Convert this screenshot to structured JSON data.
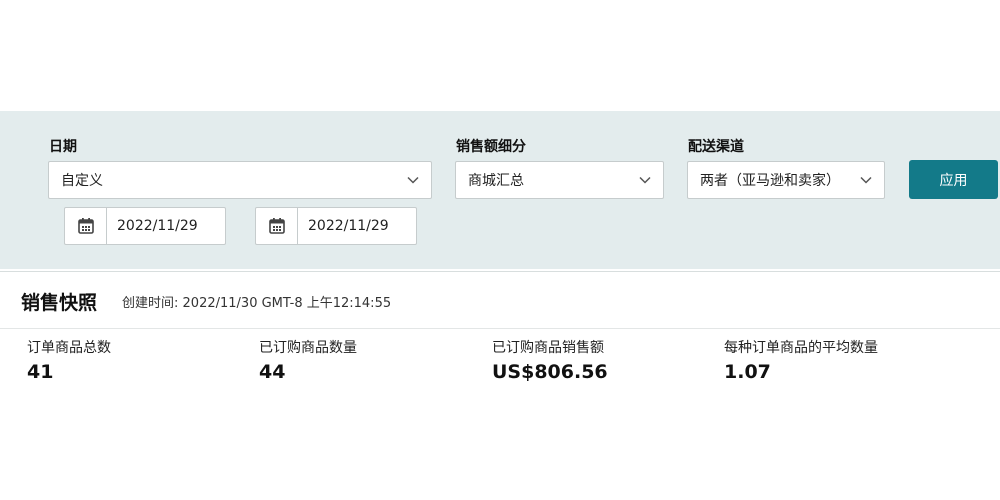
{
  "filters": {
    "date": {
      "label": "日期",
      "selected": "自定义",
      "start": "2022/11/29",
      "end": "2022/11/29"
    },
    "sales_breakdown": {
      "label": "销售额细分",
      "selected": "商城汇总"
    },
    "fulfillment": {
      "label": "配送渠道",
      "selected": "两者（亚马逊和卖家）"
    },
    "apply_label": "应用"
  },
  "snapshot": {
    "title": "销售快照",
    "created_label": "创建时间:",
    "created_value": "2022/11/30 GMT-8 上午12:14:55",
    "metrics": [
      {
        "label": "订单商品总数",
        "value": "41"
      },
      {
        "label": "已订购商品数量",
        "value": "44"
      },
      {
        "label": "已订购商品销售额",
        "value": "US$806.56"
      },
      {
        "label": "每种订单商品的平均数量",
        "value": "1.07"
      }
    ]
  },
  "colors": {
    "panel_bg": "#e3eced",
    "accent": "#137a89"
  },
  "icons": [
    "calendar-icon",
    "chevron-down-icon"
  ]
}
